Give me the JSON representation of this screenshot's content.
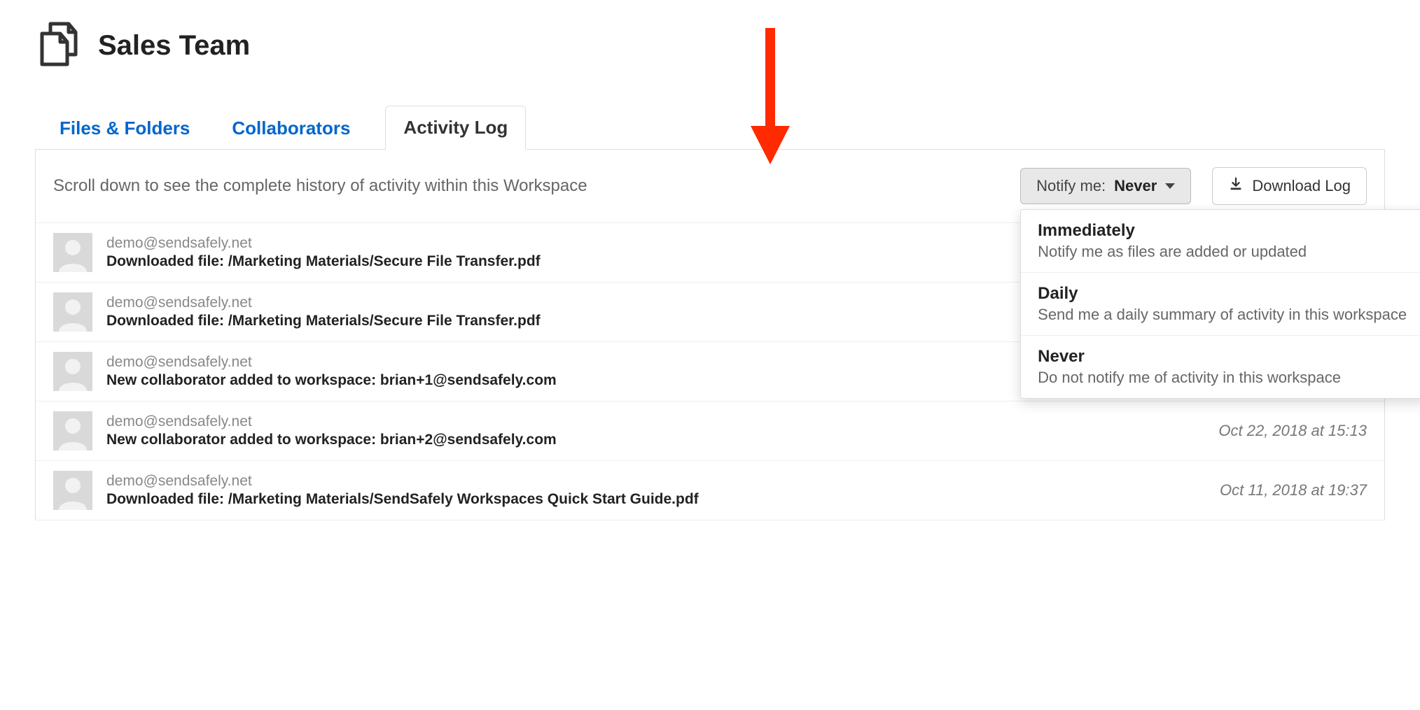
{
  "header": {
    "title": "Sales Team"
  },
  "tabs": {
    "files": "Files & Folders",
    "collaborators": "Collaborators",
    "activity": "Activity Log"
  },
  "panel": {
    "instructions": "Scroll down to see the complete history of activity within this Workspace",
    "notify_prefix": "Notify me: ",
    "notify_value": "Never",
    "download_label": "Download Log"
  },
  "notify_options": [
    {
      "title": "Immediately",
      "desc": "Notify me as files are added or updated"
    },
    {
      "title": "Daily",
      "desc": "Send me a daily summary of activity in this workspace"
    },
    {
      "title": "Never",
      "desc": "Do not notify me of activity in this workspace"
    }
  ],
  "activities": [
    {
      "email": "demo@sendsafely.net",
      "action": "Downloaded file: /Marketing Materials/Secure File Transfer.pdf",
      "timestamp": ""
    },
    {
      "email": "demo@sendsafely.net",
      "action": "Downloaded file: /Marketing Materials/Secure File Transfer.pdf",
      "timestamp": ""
    },
    {
      "email": "demo@sendsafely.net",
      "action": "New collaborator added to workspace: brian+1@sendsafely.com",
      "timestamp": ""
    },
    {
      "email": "demo@sendsafely.net",
      "action": "New collaborator added to workspace: brian+2@sendsafely.com",
      "timestamp": "Oct 22, 2018 at 15:13"
    },
    {
      "email": "demo@sendsafely.net",
      "action": "Downloaded file: /Marketing Materials/SendSafely Workspaces Quick Start Guide.pdf",
      "timestamp": "Oct 11, 2018 at 19:37"
    }
  ]
}
